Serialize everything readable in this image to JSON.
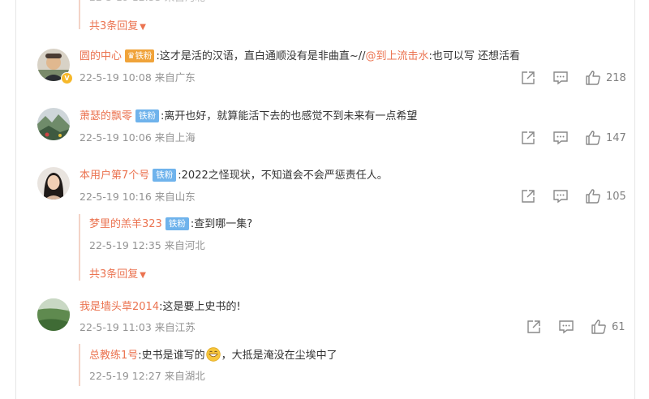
{
  "top": {
    "more_label": "共3条回复"
  },
  "comments": [
    {
      "user": "圆的中心",
      "badge": "铁粉",
      "text_before": ":这才是活的汉语，直白通顺没有是非曲直~//",
      "mention": "@到上流击水",
      "text_after": ":也可以写 还想活看",
      "meta": "22-5-19 10:08 来自广东",
      "likes": "218"
    },
    {
      "user": "萧瑟的飘零",
      "badge": "铁粉",
      "text": ":离开也好，就算能活下去的也感觉不到未来有一点希望",
      "meta": "22-5-19 10:06 来自上海",
      "likes": "147"
    },
    {
      "user": "本用户第7个号",
      "badge": "铁粉",
      "text": ":2022之怪现状，不知道会不会严惩责任人。",
      "meta": "22-5-19 10:16 来自山东",
      "likes": "105",
      "reply": {
        "user": "梦里的羔羊323",
        "badge": "铁粉",
        "text": ":查到哪一集?",
        "meta": "22-5-19 12:35 来自河北"
      },
      "more_label": "共3条回复"
    },
    {
      "user": "我是墙头草2014",
      "text": ":这是要上史书的!",
      "meta": "22-5-19 11:03 来自江苏",
      "likes": "61",
      "reply": {
        "user": "总教练1号",
        "text_before": ":史书是谁写的",
        "text_after": "，大抵是淹没在尘埃中了",
        "meta": "22-5-19 12:27 来自湖北"
      }
    }
  ]
}
